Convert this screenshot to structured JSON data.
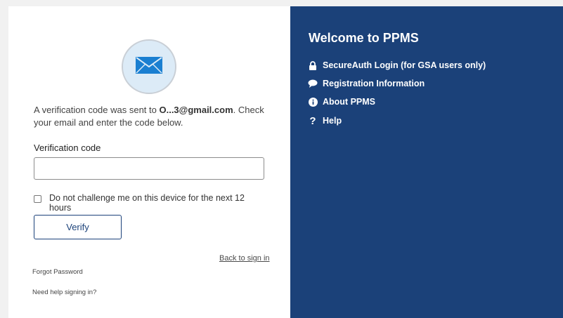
{
  "verification": {
    "intro_prefix": "A verification code was sent to ",
    "email_masked": "O...3@gmail.com",
    "intro_suffix": ". Check your email and enter the code below.",
    "code_label": "Verification code",
    "code_value": "",
    "remember_label": "Do not challenge me on this device for the next 12 hours",
    "remember_checked": false,
    "verify_label": "Verify",
    "back_link": "Back to sign in",
    "forgot_password": "Forgot Password",
    "need_help": "Need help signing in?"
  },
  "sidebar": {
    "title": "Welcome to PPMS",
    "items": [
      {
        "label": "SecureAuth Login (for GSA users only)",
        "icon": "lock-icon"
      },
      {
        "label": "Registration Information",
        "icon": "speech-bubble-icon"
      },
      {
        "label": "About PPMS",
        "icon": "info-icon"
      },
      {
        "label": "Help",
        "icon": "question-icon"
      }
    ]
  },
  "colors": {
    "brand_navy": "#1b4179",
    "envelope_blue": "#1a7fd1",
    "circle_bg": "#dcebf7"
  }
}
